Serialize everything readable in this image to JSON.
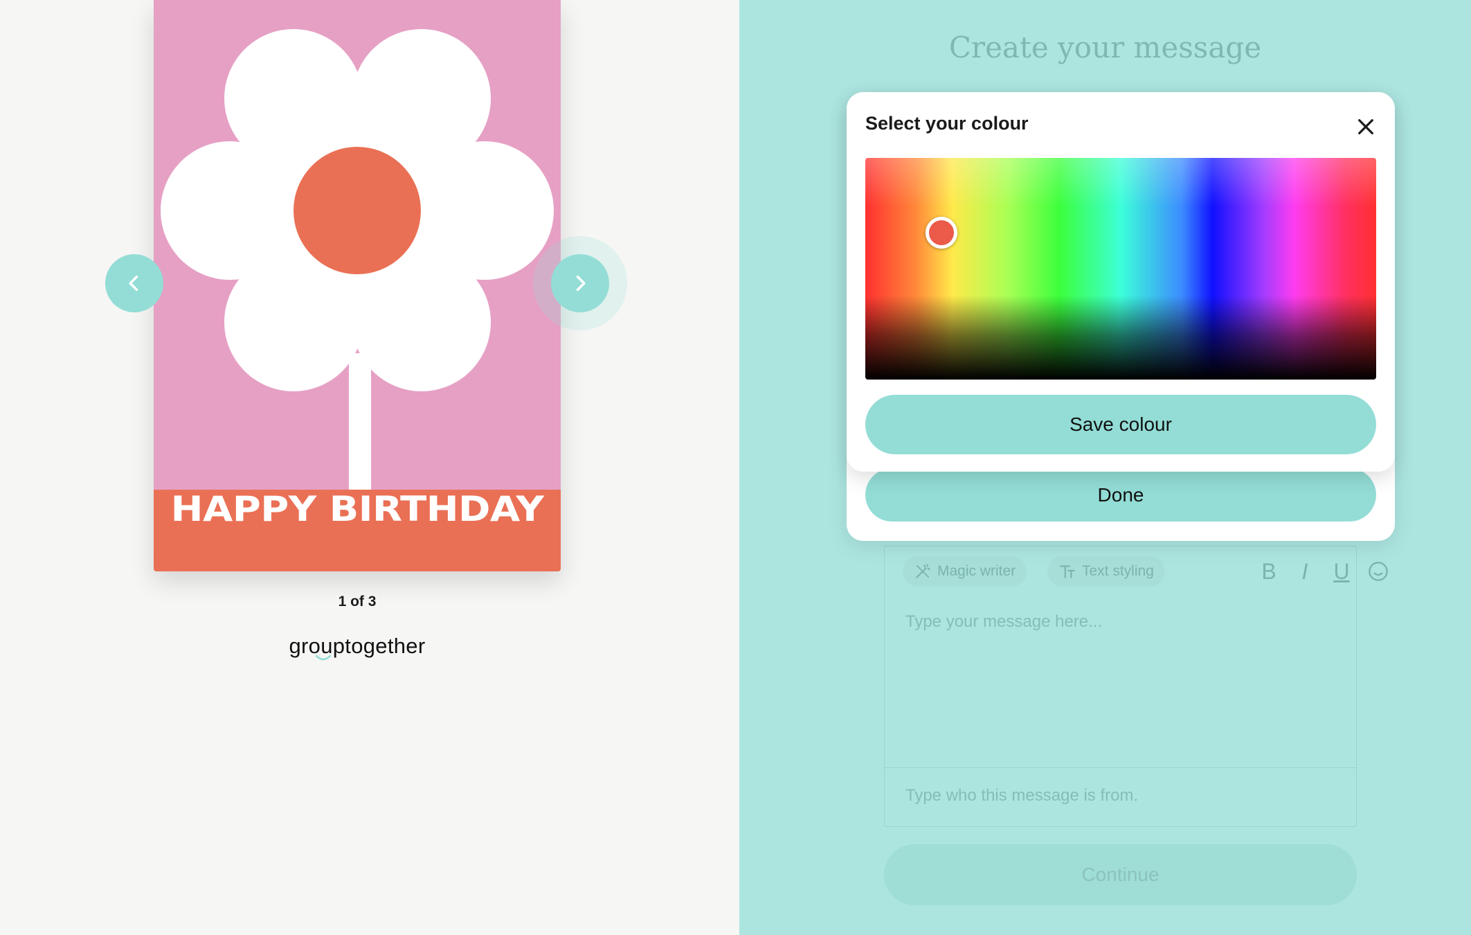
{
  "preview": {
    "card": {
      "title": "HAPPY BIRTHDAY",
      "background_color": "#e6a0c4",
      "banner_color": "#ea7055",
      "flower_center_color": "#ea7055"
    },
    "prev_icon": "chevron-left-icon",
    "next_icon": "chevron-right-icon",
    "pager": "1 of 3",
    "brand": "grouptogether"
  },
  "composer": {
    "heading": "Create your message",
    "toolbar": {
      "magic_writer": "Magic writer",
      "text_styling": "Text styling",
      "bold": "B",
      "italic": "I",
      "underline": "U"
    },
    "message_placeholder": "Type your message here...",
    "from_placeholder": "Type who this message is from.",
    "continue_label": "Continue",
    "done_label": "Done"
  },
  "colour_picker": {
    "title": "Select your colour",
    "save_label": "Save colour",
    "selected_color": "#ec5a49"
  },
  "colors": {
    "accent": "#93ddd6",
    "right_panel_bg": "#ace5e0",
    "left_panel_bg": "#f6f6f5"
  }
}
